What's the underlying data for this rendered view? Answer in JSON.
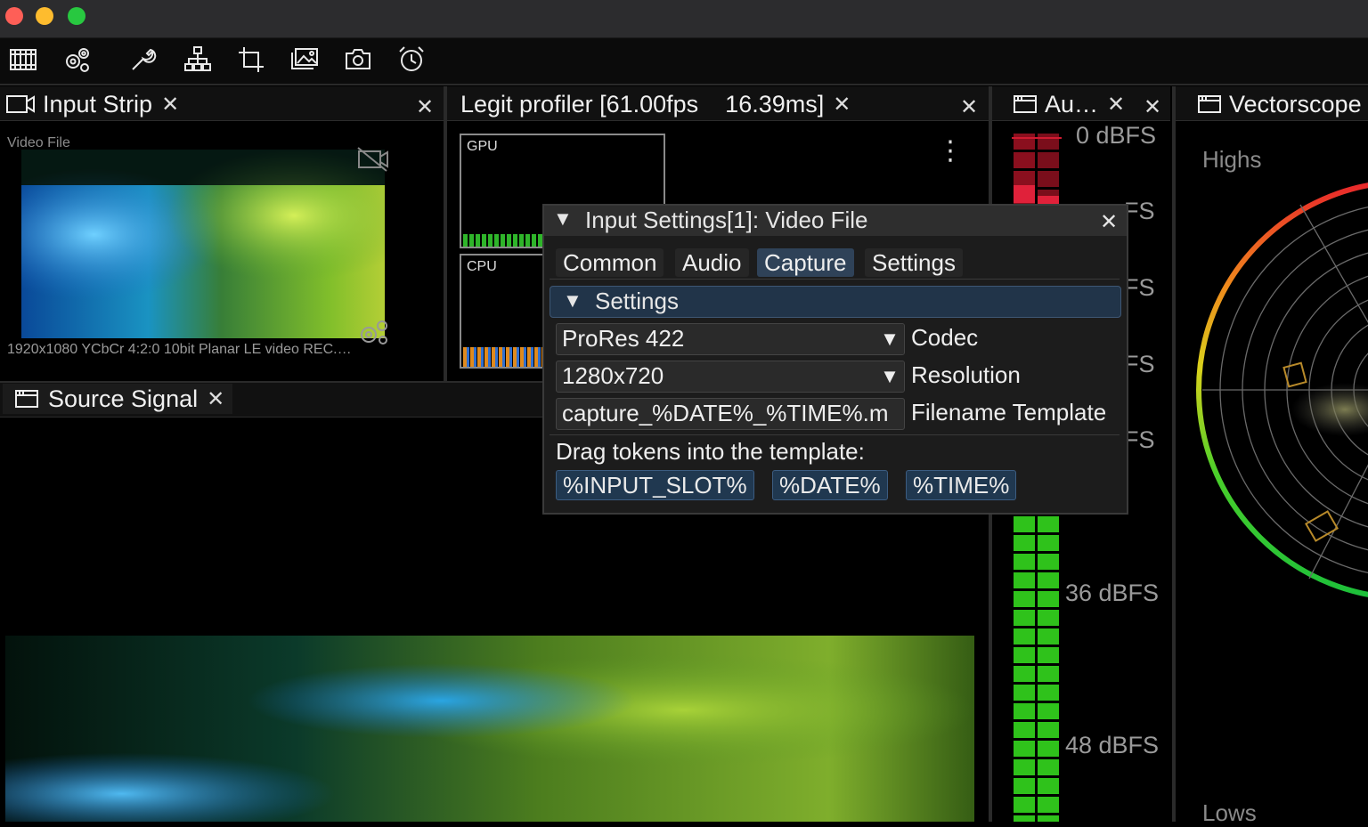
{
  "panels": {
    "input_strip": {
      "tab_title": "Input Strip",
      "source_label": "Video File",
      "video_info": "1920x1080 YCbCr 4:2:0 10bit Planar LE video REC.…"
    },
    "profiler": {
      "tab_title": "Legit profiler [61.00fps",
      "tab_ms": "16.39ms]",
      "gpu_label": "GPU",
      "cpu_label": "CPU"
    },
    "audio": {
      "tab_title": "Au…",
      "labels": [
        "0 dBFS",
        "FS",
        "FS",
        "FS",
        "FS",
        "36 dBFS",
        "48 dBFS"
      ]
    },
    "vectorscope": {
      "tab_title": "Vectorscope",
      "highs": "Highs",
      "lows": "Lows"
    },
    "source_signal": {
      "tab_title": "Source Signal"
    }
  },
  "modal": {
    "title": "Input Settings[1]: Video File",
    "tabs": [
      "Common",
      "Audio",
      "Capture",
      "Settings"
    ],
    "active_tab": "Capture",
    "section_title": "Settings",
    "codec": {
      "value": "ProRes 422",
      "label": "Codec"
    },
    "resolution": {
      "value": "1280x720",
      "label": "Resolution"
    },
    "filename_template": {
      "value": "capture_%DATE%_%TIME%.m",
      "label": "Filename Template"
    },
    "tokens_hint": "Drag tokens into the template:",
    "tokens": [
      "%INPUT_SLOT%",
      "%DATE%",
      "%TIME%"
    ]
  },
  "glyphs": {
    "close": "✕",
    "triangle_down": "▼",
    "kebab": "⋮"
  },
  "colors": {
    "accent_tab": "#2f4258",
    "meter_green": "#2fc21b",
    "meter_red": "#e0213a"
  }
}
